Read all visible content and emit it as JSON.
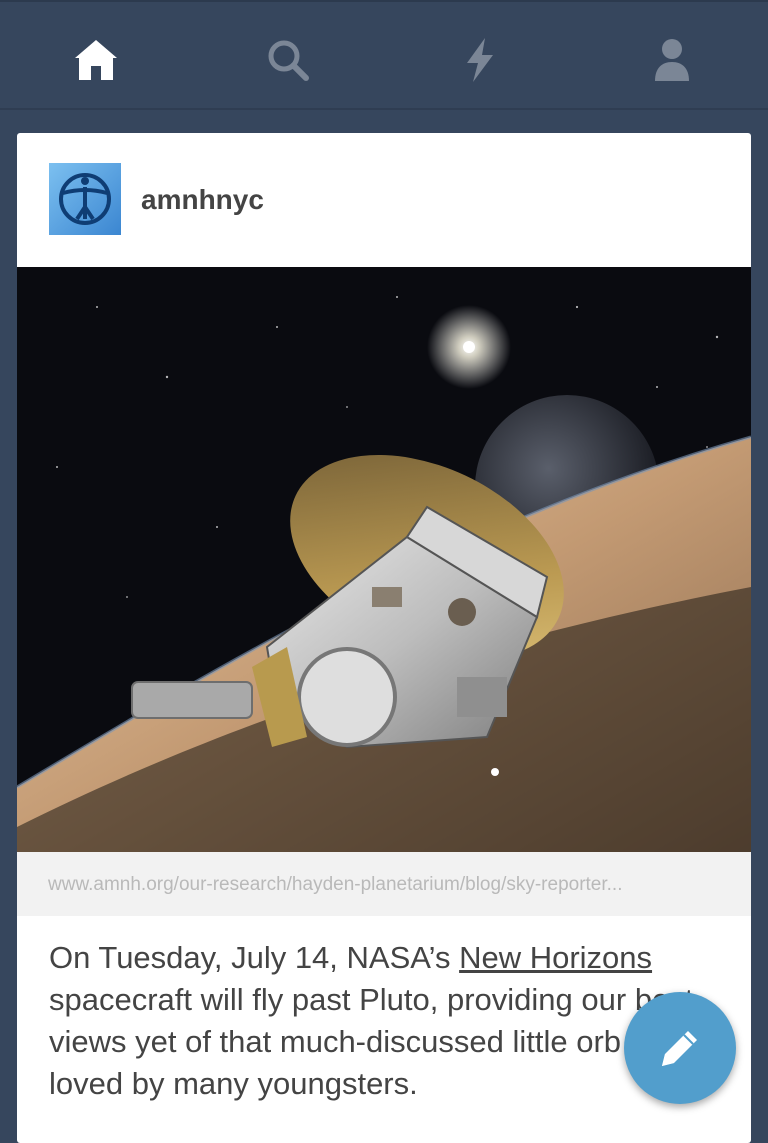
{
  "nav": {
    "items": [
      {
        "name": "home",
        "icon": "home-icon",
        "active": true
      },
      {
        "name": "search",
        "icon": "search-icon",
        "active": false
      },
      {
        "name": "activity",
        "icon": "lightning-icon",
        "active": false
      },
      {
        "name": "account",
        "icon": "person-icon",
        "active": false
      }
    ],
    "active_color": "#ffffff",
    "inactive_color": "#7b8696"
  },
  "post": {
    "blog_name": "amnhnyc",
    "avatar_icon": "amnh-logo",
    "photo_subject": "spacecraft-illustration",
    "link_url": "www.amnh.org/our-research/hayden-planetarium/blog/sky-reporter...",
    "body_before": "On Tuesday, July 14, NASA’s ",
    "body_link": "New Horizons",
    "body_after": " spacecraft will fly past Pluto, providing our best views yet of that much-discussed little orb so loved by many youngsters."
  },
  "compose": {
    "icon": "pencil-icon",
    "color": "#529ecc"
  }
}
